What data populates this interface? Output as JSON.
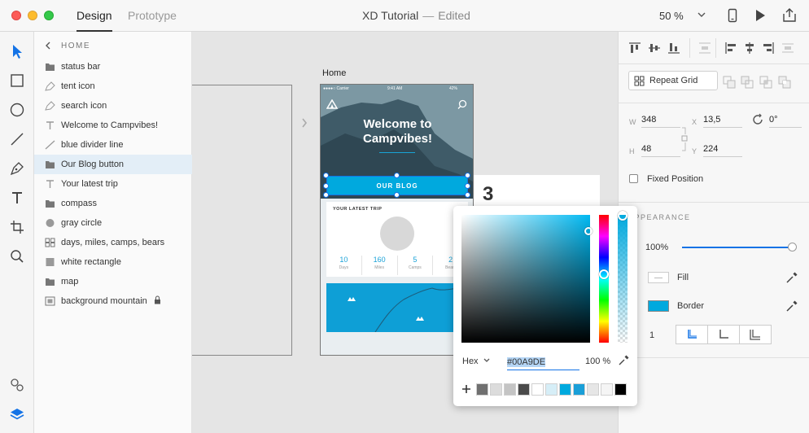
{
  "window": {
    "tabs": [
      "Design",
      "Prototype"
    ],
    "doc_name": "XD Tutorial",
    "separator": "—",
    "status": "Edited",
    "zoom": "50 %"
  },
  "layers": {
    "breadcrumb": "HOME",
    "items": [
      {
        "label": "status bar",
        "icon": "folder-icon"
      },
      {
        "label": "tent icon",
        "icon": "pen-path-icon"
      },
      {
        "label": "search icon",
        "icon": "pen-path-icon"
      },
      {
        "label": "Welcome to Campvibes!",
        "icon": "text-icon"
      },
      {
        "label": "blue divider line",
        "icon": "line-icon"
      },
      {
        "label": "Our Blog button",
        "icon": "folder-icon"
      },
      {
        "label": "Your latest trip",
        "icon": "text-icon"
      },
      {
        "label": "compass",
        "icon": "folder-icon"
      },
      {
        "label": "gray circle",
        "icon": "circle-icon"
      },
      {
        "label": "days, miles, camps, bears",
        "icon": "grid-icon"
      },
      {
        "label": "white rectangle",
        "icon": "square-icon"
      },
      {
        "label": "map",
        "icon": "folder-icon"
      },
      {
        "label": "background mountain",
        "icon": "image-icon"
      }
    ],
    "selected_index": 5
  },
  "canvas": {
    "artboard_name": "Home",
    "phone": {
      "carrier": "●●●●○ Carrier",
      "time": "9:41 AM",
      "battery": "42%",
      "hero_title_1": "Welcome to",
      "hero_title_2": "Campvibes!",
      "button_label": "OUR BLOG",
      "card_title": "YOUR LATEST TRIP",
      "stats": [
        {
          "value": "10",
          "label": "Days"
        },
        {
          "value": "160",
          "label": "Miles"
        },
        {
          "value": "5",
          "label": "Camps"
        },
        {
          "value": "2",
          "label": "Bears"
        }
      ]
    },
    "step_number": "3"
  },
  "inspector": {
    "repeat_grid": "Repeat Grid",
    "w_label": "W",
    "w": "348",
    "x_label": "X",
    "x": "13,5",
    "h_label": "H",
    "h": "48",
    "y_label": "Y",
    "y": "224",
    "rotation": "0°",
    "fixed_position": "Fixed Position",
    "appearance": "APPEARANCE",
    "opacity": "100%",
    "fill_label": "Fill",
    "border_label": "Border",
    "border_width": "1",
    "border_color": "#00A9DE"
  },
  "color_picker": {
    "mode": "Hex",
    "hex": "#00A9DE",
    "alpha": "100 %",
    "swatches": [
      "#707070",
      "#dcdcdc",
      "#c4c4c4",
      "#4a4a4a",
      "#ffffff",
      "#d6eef7",
      "#00a9de",
      "#1a9fd8",
      "#e6e6e6",
      "#f5f5f5",
      "#000000"
    ]
  }
}
